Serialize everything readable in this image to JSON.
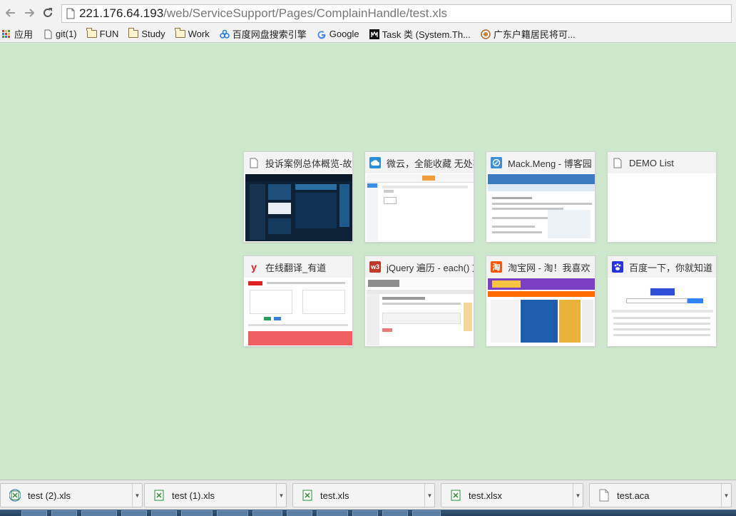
{
  "toolbar": {
    "url_host": "221.176.64.193",
    "url_path": "/web/ServiceSupport/Pages/ComplainHandle/test.xls"
  },
  "bookmarks": [
    {
      "label": "应用",
      "icon": "apps-icon"
    },
    {
      "label": "git(1)",
      "icon": "page-icon"
    },
    {
      "label": "FUN",
      "icon": "folder-icon"
    },
    {
      "label": "Study",
      "icon": "folder-icon"
    },
    {
      "label": "Work",
      "icon": "folder-icon"
    },
    {
      "label": "百度网盘搜索引擎",
      "icon": "baidu-pan-icon"
    },
    {
      "label": "Google",
      "icon": "google-icon"
    },
    {
      "label": "Task 类 (System.Th...",
      "icon": "msdn-icon"
    },
    {
      "label": "广东户籍居民将可...",
      "icon": "news-icon"
    }
  ],
  "tiles": [
    {
      "title": "投诉案例总体概览-故障",
      "icon": "page-icon",
      "fav_color": "#ffffff"
    },
    {
      "title": "微云，全能收藏 无处不",
      "icon": "weiyun-icon",
      "fav_color": "#2a8fd6"
    },
    {
      "title": "Mack.Meng - 博客园",
      "icon": "cnblogs-icon",
      "fav_color": "#3a8fd8"
    },
    {
      "title": "DEMO List",
      "icon": "page-icon",
      "fav_color": "#ffffff"
    },
    {
      "title": "在线翻译_有道",
      "icon": "youdao-icon",
      "fav_color": "#e02020"
    },
    {
      "title": "jQuery 遍历 - each() 方",
      "icon": "w3school-icon",
      "fav_color": "#c0392b"
    },
    {
      "title": "淘宝网 - 淘！我喜欢",
      "icon": "taobao-icon",
      "fav_color": "#ff5500"
    },
    {
      "title": "百度一下，你就知道",
      "icon": "baidu-icon",
      "fav_color": "#2932e1"
    }
  ],
  "downloads": [
    {
      "name": "test (2).xls",
      "icon": "excel-file-icon"
    },
    {
      "name": "test (1).xls",
      "icon": "excel-file-icon"
    },
    {
      "name": "test.xls",
      "icon": "excel-file-icon"
    },
    {
      "name": "test.xlsx",
      "icon": "excel-file-icon"
    },
    {
      "name": "test.aca",
      "icon": "file-icon"
    }
  ],
  "colors": {
    "page_background": "#cde7cc",
    "chrome_toolbar": "#f2f2f2",
    "excel_green": "#2e8b3a"
  }
}
